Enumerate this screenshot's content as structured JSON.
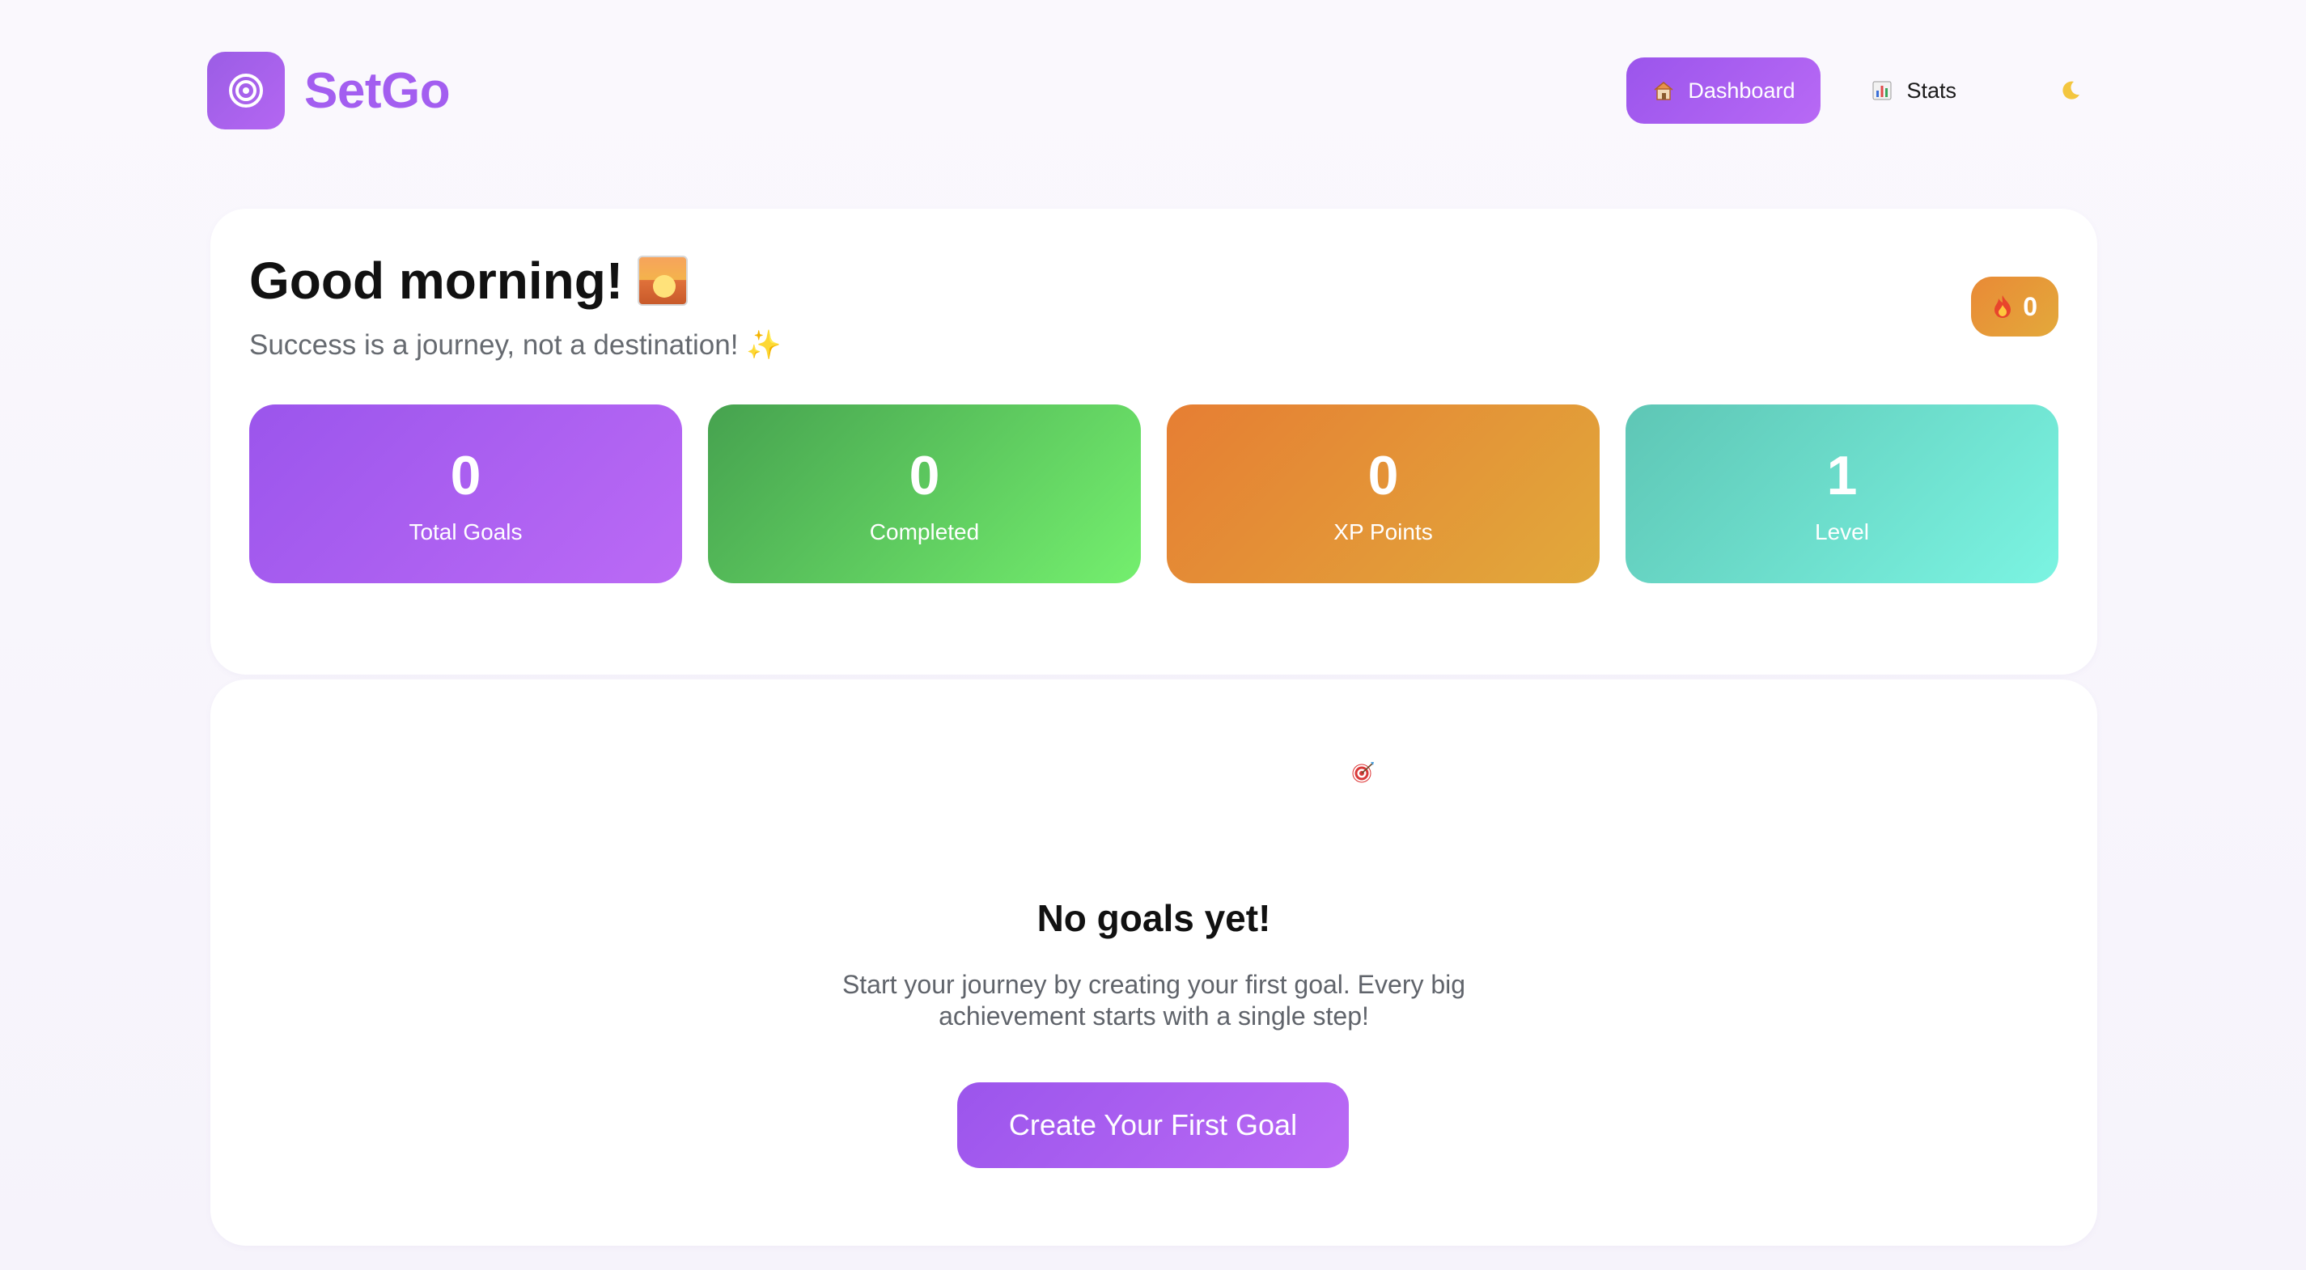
{
  "brand": {
    "name": "SetGo",
    "logo_icon": "target-icon"
  },
  "nav": {
    "dashboard": {
      "label": "Dashboard",
      "icon": "house-icon",
      "active": true
    },
    "stats": {
      "label": "Stats",
      "icon": "bar-chart-icon",
      "active": false
    },
    "theme_toggle_icon": "moon-icon"
  },
  "welcome": {
    "greeting": "Good morning!",
    "greeting_icon": "sunrise-icon",
    "subtitle": "Success is a journey, not a destination! ✨",
    "streak": {
      "icon": "fire-icon",
      "value": "0"
    }
  },
  "stats": [
    {
      "value": "0",
      "label": "Total Goals",
      "color": "#a35ef0"
    },
    {
      "value": "0",
      "label": "Completed",
      "color": "#5cc85e"
    },
    {
      "value": "0",
      "label": "XP Points",
      "color": "#e39337"
    },
    {
      "value": "1",
      "label": "Level",
      "color": "#6ddccb"
    }
  ],
  "empty_state": {
    "icon": "target-icon",
    "title": "No goals yet!",
    "description": "Start your journey by creating your first goal. Every big achievement starts with a single step!",
    "cta_label": "Create Your First Goal"
  },
  "colors": {
    "accent": "#a35ef0",
    "background": "#f8f5fc",
    "card": "#ffffff"
  }
}
